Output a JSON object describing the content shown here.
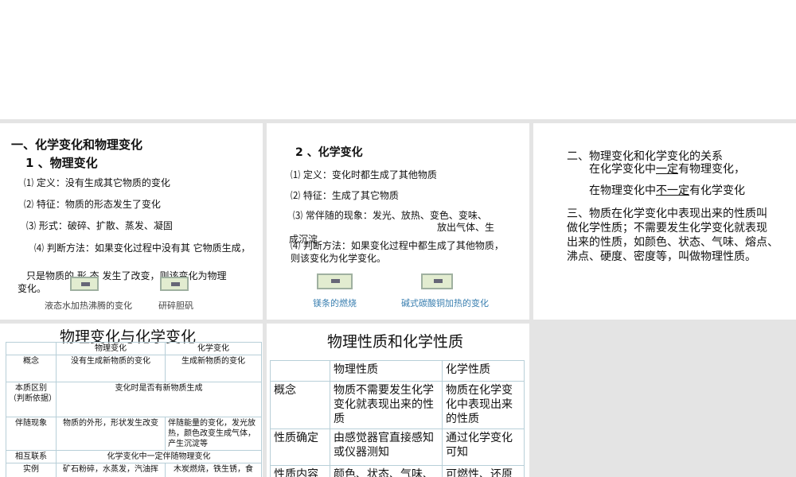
{
  "slide1": {
    "heading": "一、化学变化和物理变化",
    "subheading": "1 、物理变化",
    "items": [
      "⑴ 定义：没有生成其它物质的变化",
      "⑵ 特征：物质的形态发生了变化",
      "⑶ 形式：破碎、扩散、蒸发、凝固",
      "⑷ 判断方法：如果变化过程中没有其 它物质生成，"
    ],
    "cont1": "只是物质的 形 态 发生了改变，则该变化为物理",
    "cont2": "变化。",
    "captions": [
      "液态水加热沸腾的变化",
      "研碎胆矾"
    ]
  },
  "slide2": {
    "subheading": "2 、化学变化",
    "items": [
      "⑴ 定义：变化时都生成了其他物质",
      "⑵ 特征：生成了其它物质",
      "⑶ 常伴随的现象：发光、放热、变色、变味、"
    ],
    "item3b": "放出气体、生",
    "item3c": "成沉淀",
    "item4a": "⑷ 判断方法：如果变化过程中都生成了其他物质，",
    "item4b": "则该变化为化学变化。",
    "captions": [
      "镁条的燃烧",
      "碱式碳酸铜加热的变化"
    ]
  },
  "slide3": {
    "heading": "二、物理变化和化学变化的关系",
    "line1a": "在化学变化中",
    "line1u": "一定",
    "line1b": "有物理变化，",
    "line2a": "在物理变化中",
    "line2u": "不一定",
    "line2b": "有化学变化",
    "para": [
      "三、物质在化学变化中表现出来的性质叫",
      "做化学性质；不需要发生化学变化就表现",
      "出来的性质，如颜色、状态、气味、熔点、",
      "沸点、硬度、密度等，叫做物理性质。"
    ]
  },
  "slide4": {
    "title": "物理变化与化学变化",
    "headers": [
      "",
      "物理变化",
      "化学变化"
    ],
    "rows": [
      [
        "概念",
        "没有生成新物质的变化",
        "生成新物质的变化"
      ],
      [
        "本质区别（判断依据）",
        "变化时是否有新物质生成"
      ],
      [
        "伴随现象",
        "物质的外形，形状发生改变",
        "伴随能量的变化，发光放热，颜色改变生成气体，产生沉淀等"
      ],
      [
        "相互联系",
        "化学变化中一定伴随物理变化"
      ],
      [
        "实例",
        "矿石粉碎，水蒸发，汽油挥",
        "木炭燃烧，铁生锈，食"
      ]
    ]
  },
  "slide5": {
    "title": "物理性质和化学性质",
    "headers": [
      "",
      "物理性质",
      "化学性质"
    ],
    "rows": [
      [
        "概念",
        "物质不需要发生化学变化就表现出来的性质",
        "物质在化学变化中表现出来的性质"
      ],
      [
        "性质确定",
        "由感觉器官直接感知或仪器测知",
        "通过化学变化可知"
      ],
      [
        "性质内容",
        "颜色、状态、气味、",
        "可燃性、还原"
      ]
    ]
  }
}
